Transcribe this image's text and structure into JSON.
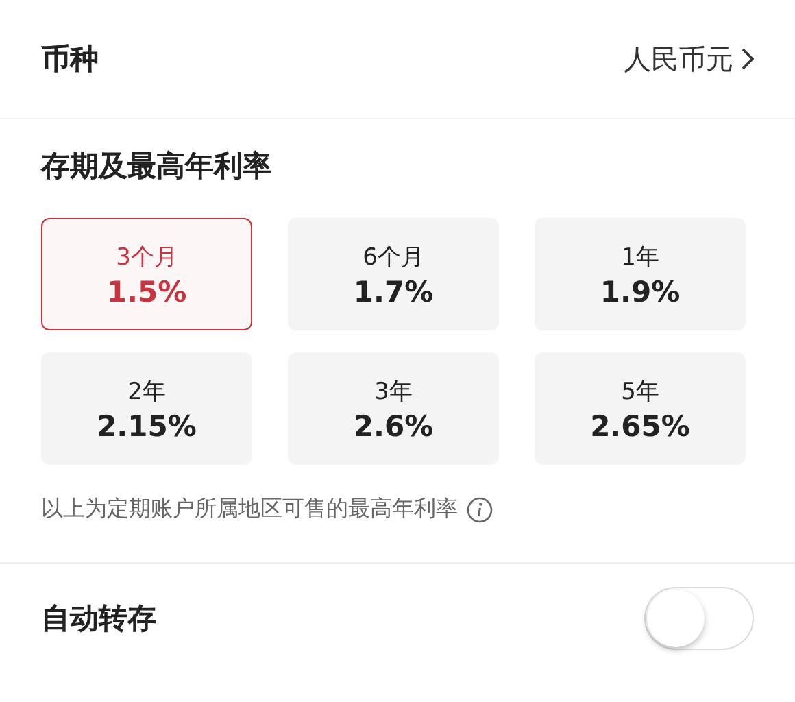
{
  "currency": {
    "label": "币种",
    "value": "人民币元"
  },
  "terms": {
    "title": "存期及最高年利率",
    "options": [
      {
        "label": "3个月",
        "rate": "1.5%",
        "selected": true
      },
      {
        "label": "6个月",
        "rate": "1.7%",
        "selected": false
      },
      {
        "label": "1年",
        "rate": "1.9%",
        "selected": false
      },
      {
        "label": "2年",
        "rate": "2.15%",
        "selected": false
      },
      {
        "label": "3年",
        "rate": "2.6%",
        "selected": false
      },
      {
        "label": "5年",
        "rate": "2.65%",
        "selected": false
      }
    ],
    "note": "以上为定期账户所属地区可售的最高年利率"
  },
  "auto_renew": {
    "label": "自动转存",
    "on": false
  }
}
